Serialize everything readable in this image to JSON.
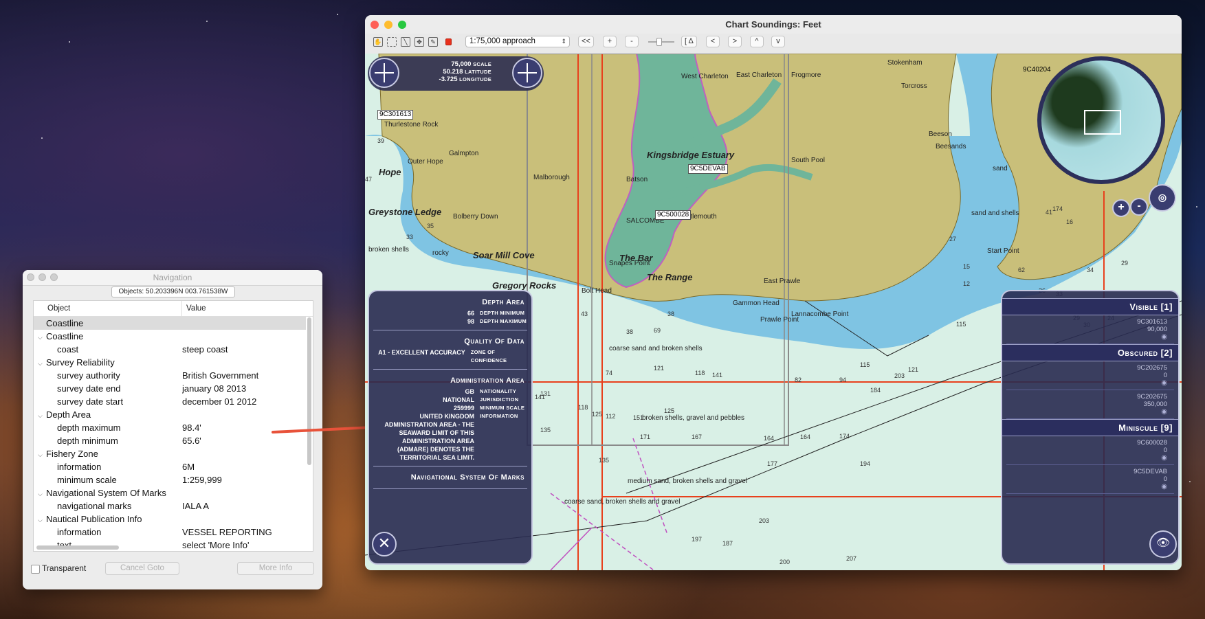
{
  "navigation": {
    "title": "Navigation",
    "objects_label": "Objects: 50.203396N 003.761538W",
    "columns": [
      "Object",
      "Value"
    ],
    "rows": [
      {
        "key": "Coastline",
        "value": "",
        "indent": 0,
        "chevron": "",
        "selected": true
      },
      {
        "key": "Coastline",
        "value": "",
        "indent": 0,
        "chevron": "v"
      },
      {
        "key": "coast",
        "value": "steep coast",
        "indent": 1,
        "chevron": ""
      },
      {
        "key": "Survey Reliability",
        "value": "",
        "indent": 0,
        "chevron": "v"
      },
      {
        "key": "survey authority",
        "value": "British Government",
        "indent": 1,
        "chevron": ""
      },
      {
        "key": "survey date end",
        "value": "january 08 2013",
        "indent": 1,
        "chevron": ""
      },
      {
        "key": "survey date start",
        "value": "december 01 2012",
        "indent": 1,
        "chevron": ""
      },
      {
        "key": "Depth Area",
        "value": "",
        "indent": 0,
        "chevron": "v"
      },
      {
        "key": "depth maximum",
        "value": "98.4'",
        "indent": 1,
        "chevron": ""
      },
      {
        "key": "depth minimum",
        "value": "65.6'",
        "indent": 1,
        "chevron": ""
      },
      {
        "key": "Fishery Zone",
        "value": "",
        "indent": 0,
        "chevron": "v"
      },
      {
        "key": "information",
        "value": "6M",
        "indent": 1,
        "chevron": ""
      },
      {
        "key": "minimum scale",
        "value": "1:259,999",
        "indent": 1,
        "chevron": ""
      },
      {
        "key": "Navigational System Of Marks",
        "value": "",
        "indent": 0,
        "chevron": "v"
      },
      {
        "key": "navigational marks",
        "value": "IALA A",
        "indent": 1,
        "chevron": ""
      },
      {
        "key": "Nautical Publication Info",
        "value": "",
        "indent": 0,
        "chevron": "v"
      },
      {
        "key": "information",
        "value": "VESSEL REPORTING",
        "indent": 1,
        "chevron": ""
      },
      {
        "key": "text",
        "value": "select 'More Info'",
        "indent": 1,
        "chevron": ""
      }
    ],
    "transparent_label": "Transparent",
    "cancel_goto_label": "Cancel Goto",
    "more_info_label": "More Info"
  },
  "chart_window": {
    "title": "Chart  Soundings: Feet",
    "scale_select": "1:75,000 approach",
    "buttons": {
      "rewind": "<<",
      "zoom_in": "+",
      "zoom_out": "-",
      "delta": "[ Δ",
      "left": "<",
      "right": ">",
      "up": "^",
      "down": "v"
    },
    "hud": {
      "scale_value": "75,000",
      "scale_label": "SCALE",
      "lat_value": "50.218",
      "lat_label": "LATITUDE",
      "lon_value": "-3.725",
      "lon_label": "LONGITUDE"
    },
    "chips": [
      "9C301613",
      "9C5DEVAB",
      "9C500028",
      "9C40204"
    ],
    "place_names": [
      "Greystone Ledge",
      "Soar Mill Cove",
      "Gregory Rocks",
      "The Bar",
      "The Range",
      "Hope",
      "Kingsbridge Estuary",
      "SALCOMBE",
      "East Portlemouth",
      "Bolt Head",
      "Gammon Head",
      "Prawle Point",
      "Lannacombe Point",
      "Start Point"
    ],
    "small_labels": [
      "Thurlestone Rock",
      "Outer Hope",
      "Galmpton",
      "Malborough",
      "Bolberry Down",
      "West Charleton",
      "East Charleton",
      "Frogmore",
      "Stokenham",
      "Torcross",
      "Beeson",
      "Beesands",
      "South Pool",
      "Batson",
      "Snapes Point",
      "East Prawle",
      "broken shells",
      "coarse sand and broken shells",
      "broken shells, gravel and pebbles",
      "medium sand, broken shells and gravel",
      "coarse sand, broken shells and gravel",
      "sand and shells",
      "sand",
      "rocky"
    ],
    "soundings": [
      "39",
      "47",
      "35",
      "33",
      "38",
      "43",
      "38",
      "69",
      "74",
      "125",
      "121",
      "118",
      "141",
      "112",
      "151",
      "125",
      "135",
      "171",
      "167",
      "164",
      "164",
      "174",
      "184",
      "121",
      "115",
      "141",
      "118",
      "131",
      "135",
      "194",
      "177",
      "203",
      "197",
      "187",
      "200",
      "207",
      "203",
      "115",
      "174",
      "41",
      "27",
      "15",
      "12",
      "16",
      "29",
      "34",
      "33",
      "24",
      "26",
      "17",
      "29",
      "30",
      "62",
      "94",
      "82"
    ],
    "left_panel": {
      "sections": [
        {
          "title": "Depth Area",
          "rows": [
            {
              "val": "66",
              "key": "depth minimum"
            },
            {
              "val": "98",
              "key": "depth maximum"
            }
          ]
        },
        {
          "title": "Quality Of Data",
          "rows": [
            {
              "val": "A1 - excellent accuracy",
              "key": "zone of confidence"
            }
          ]
        },
        {
          "title": "Administration Area",
          "rows": [
            {
              "val": "GB",
              "key": "nationality"
            },
            {
              "val": "national",
              "key": "jurisdiction"
            },
            {
              "val": "259999",
              "key": "minimum scale"
            },
            {
              "val": "UNITED KINGDOM ADMINISTRATION AREA - The seaward limit of this Administration Area (ADMARE) denotes the Territorial Sea Limit.",
              "key": "information"
            }
          ]
        },
        {
          "title": "Navigational System Of Marks",
          "rows": []
        }
      ],
      "close_label": "✕"
    },
    "right_panel": {
      "groups": [
        {
          "title": "Visible [1]",
          "items": [
            {
              "id": "9C301613",
              "scale": "90,000"
            }
          ]
        },
        {
          "title": "Obscured [2]",
          "items": [
            {
              "id": "9C202675",
              "scale": "0"
            },
            {
              "id": "9C202675",
              "scale": "350,000"
            }
          ]
        },
        {
          "title": "Miniscule [9]",
          "items": [
            {
              "id": "9C600028",
              "scale": "0"
            },
            {
              "id": "9C5DEVAB",
              "scale": "0"
            }
          ]
        }
      ]
    },
    "magnifier": {
      "zoom_in": "+",
      "zoom_out": "-"
    }
  },
  "colors": {
    "land": "#c9bf7a",
    "sea_shallow": "#7fc4e3",
    "sea_deep": "#d9f0e6",
    "intertidal": "#6fb59a",
    "limit_red": "#e8401c",
    "panel_bg": "#2a2c55",
    "arrow": "#e8523a"
  }
}
